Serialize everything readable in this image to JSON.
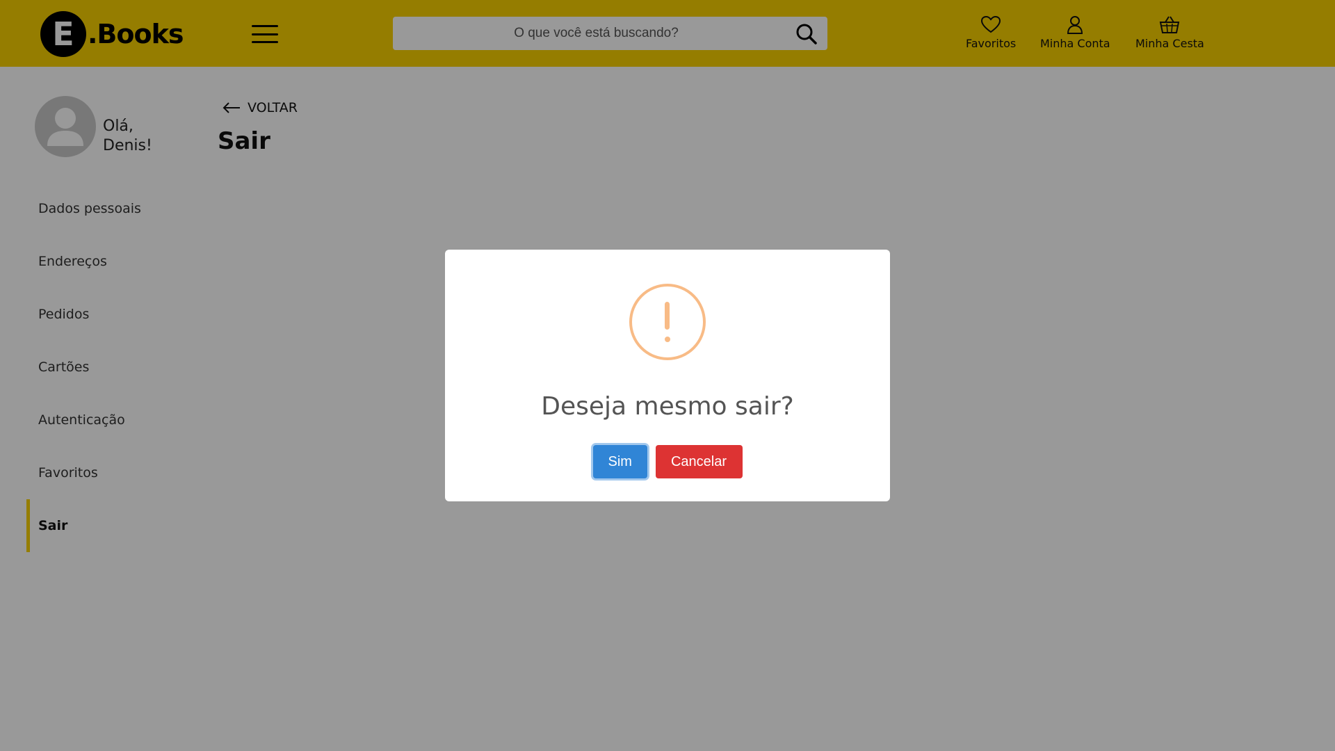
{
  "header": {
    "logo_letter": "E",
    "logo_text": ".Books",
    "search_placeholder": "O que você está buscando?",
    "actions": [
      {
        "label": "Favoritos",
        "icon": "heart-icon"
      },
      {
        "label": "Minha Conta",
        "icon": "user-icon"
      },
      {
        "label": "Minha Cesta",
        "icon": "basket-icon"
      }
    ]
  },
  "sidebar": {
    "greeting_line1": "Olá,",
    "greeting_line2": "Denis!",
    "items": [
      {
        "label": "Dados pessoais"
      },
      {
        "label": "Endereços"
      },
      {
        "label": "Pedidos"
      },
      {
        "label": "Cartões"
      },
      {
        "label": "Autenticação"
      },
      {
        "label": "Favoritos"
      },
      {
        "label": "Sair",
        "active": true
      }
    ]
  },
  "main": {
    "back_label": "VOLTAR",
    "title": "Sair"
  },
  "modal": {
    "icon": "warning-icon",
    "title": "Deseja mesmo sair?",
    "confirm_label": "Sim",
    "cancel_label": "Cancelar"
  },
  "colors": {
    "brand": "#f8d000",
    "confirm": "#3085d6",
    "cancel": "#dd3333",
    "warning": "#f8bb86"
  }
}
